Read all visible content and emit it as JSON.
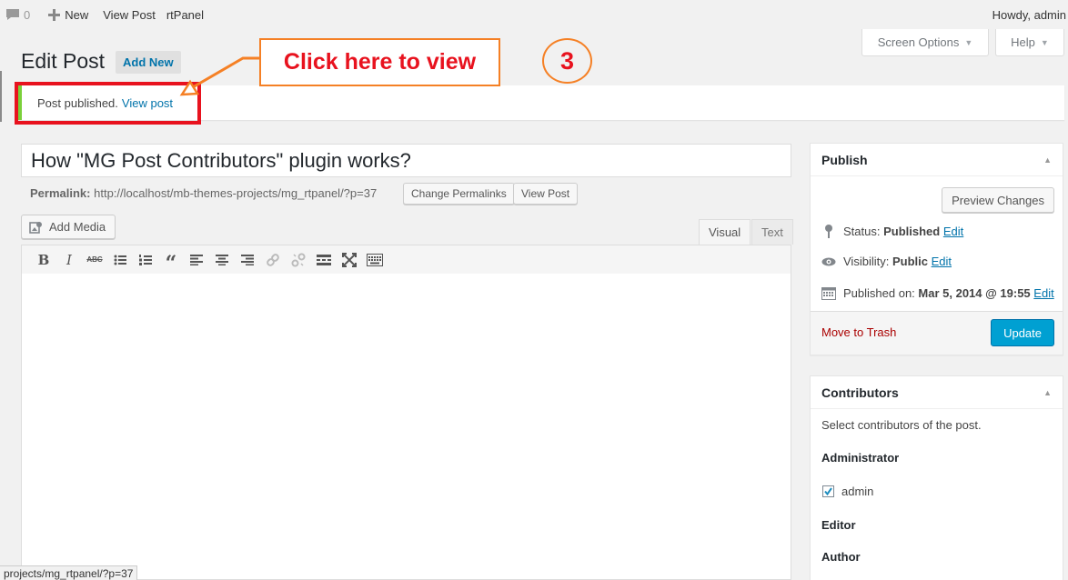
{
  "adminbar": {
    "comments_count": "0",
    "new_label": "New",
    "view_post": "View Post",
    "theme": "rtPanel",
    "howdy": "Howdy, admin"
  },
  "screen_options": {
    "screen_options_label": "Screen Options",
    "help_label": "Help"
  },
  "header": {
    "title": "Edit Post",
    "add_new": "Add New"
  },
  "notice": {
    "text": "Post published.",
    "link": "View post"
  },
  "annotation": {
    "callout": "Click here to view",
    "step": "3",
    "accent": "#f58025",
    "text_color": "#e8121e"
  },
  "post": {
    "title": "How \"MG Post Contributors\" plugin works?",
    "permalink_label": "Permalink:",
    "permalink_url": "http://localhost/mb-themes-projects/mg_rtpanel/?p=37",
    "change_permalinks": "Change Permalinks",
    "view_post": "View Post"
  },
  "editor": {
    "add_media": "Add Media",
    "tabs": [
      "Visual",
      "Text"
    ],
    "toolbar": [
      "bold-icon",
      "italic-icon",
      "strikethrough-icon",
      "bullet-list-icon",
      "numbered-list-icon",
      "blockquote-icon",
      "align-left-icon",
      "align-center-icon",
      "align-right-icon",
      "link-icon",
      "unlink-icon",
      "read-more-icon",
      "fullscreen-icon",
      "toolbar-toggle-icon"
    ]
  },
  "publish": {
    "title": "Publish",
    "preview": "Preview Changes",
    "status_label": "Status:",
    "status_value": "Published",
    "visibility_label": "Visibility:",
    "visibility_value": "Public",
    "published_label": "Published on:",
    "published_value": "Mar 5, 2014 @ 19:55",
    "edit": "Edit",
    "trash": "Move to Trash",
    "update": "Update"
  },
  "contributors": {
    "title": "Contributors",
    "description": "Select contributors of the post.",
    "groups": [
      {
        "role": "Administrator",
        "users": [
          {
            "name": "admin",
            "checked": true
          }
        ]
      },
      {
        "role": "Editor",
        "users": []
      },
      {
        "role": "Author",
        "users": []
      }
    ]
  },
  "status_bar": {
    "url": "projects/mg_rtpanel/?p=37"
  }
}
